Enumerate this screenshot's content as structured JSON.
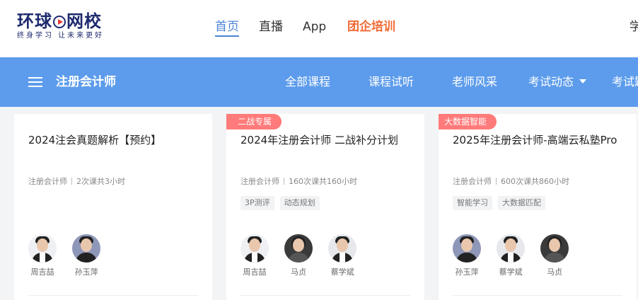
{
  "header": {
    "logo_text_a": "环球",
    "logo_text_b": "网校",
    "logo_slogan": "终身学习 让未来更好",
    "nav": [
      {
        "label": "首页",
        "active": true
      },
      {
        "label": "直播",
        "active": false
      },
      {
        "label": "App",
        "active": false
      },
      {
        "label": "团企培训",
        "active": false
      }
    ],
    "clipped_item": "学"
  },
  "category_bar": {
    "title": "注册会计师",
    "links": [
      "全部课程",
      "课程试听",
      "老师风采",
      "考试动态",
      "考试题"
    ]
  },
  "colors": {
    "brand_navy": "#1e2a6e",
    "active_blue": "#4a84d6",
    "hot_orange": "#f26a35",
    "bar_blue": "#5d9cec",
    "ribbon_red": "#ff7a7a"
  },
  "icons": {
    "menu": "hamburger-icon",
    "dropdown": "chevron-down-icon",
    "logo_play": "play-circle-icon"
  },
  "courses": [
    {
      "badge": "",
      "title": "2024注会真题解析【预约】",
      "category": "注册会计师",
      "stats": "2次课共3小时",
      "tags": [],
      "teachers": [
        "周吉喆",
        "孙玉萍"
      ]
    },
    {
      "badge": "二战专属",
      "title": "2024年注册会计师 二战补分计划",
      "category": "注册会计师",
      "stats": "160次课共160小时",
      "tags": [
        "3P测评",
        "动态规划"
      ],
      "teachers": [
        "周吉喆",
        "马贞",
        "蔡学斌"
      ]
    },
    {
      "badge": "大数据智能",
      "title": "2025年注册会计师-高端云私塾Pro",
      "category": "注册会计师",
      "stats": "600次课共860小时",
      "tags": [
        "智能学习",
        "大数据匹配"
      ],
      "teachers": [
        "孙玉萍",
        "蔡学斌",
        "马贞"
      ]
    }
  ]
}
